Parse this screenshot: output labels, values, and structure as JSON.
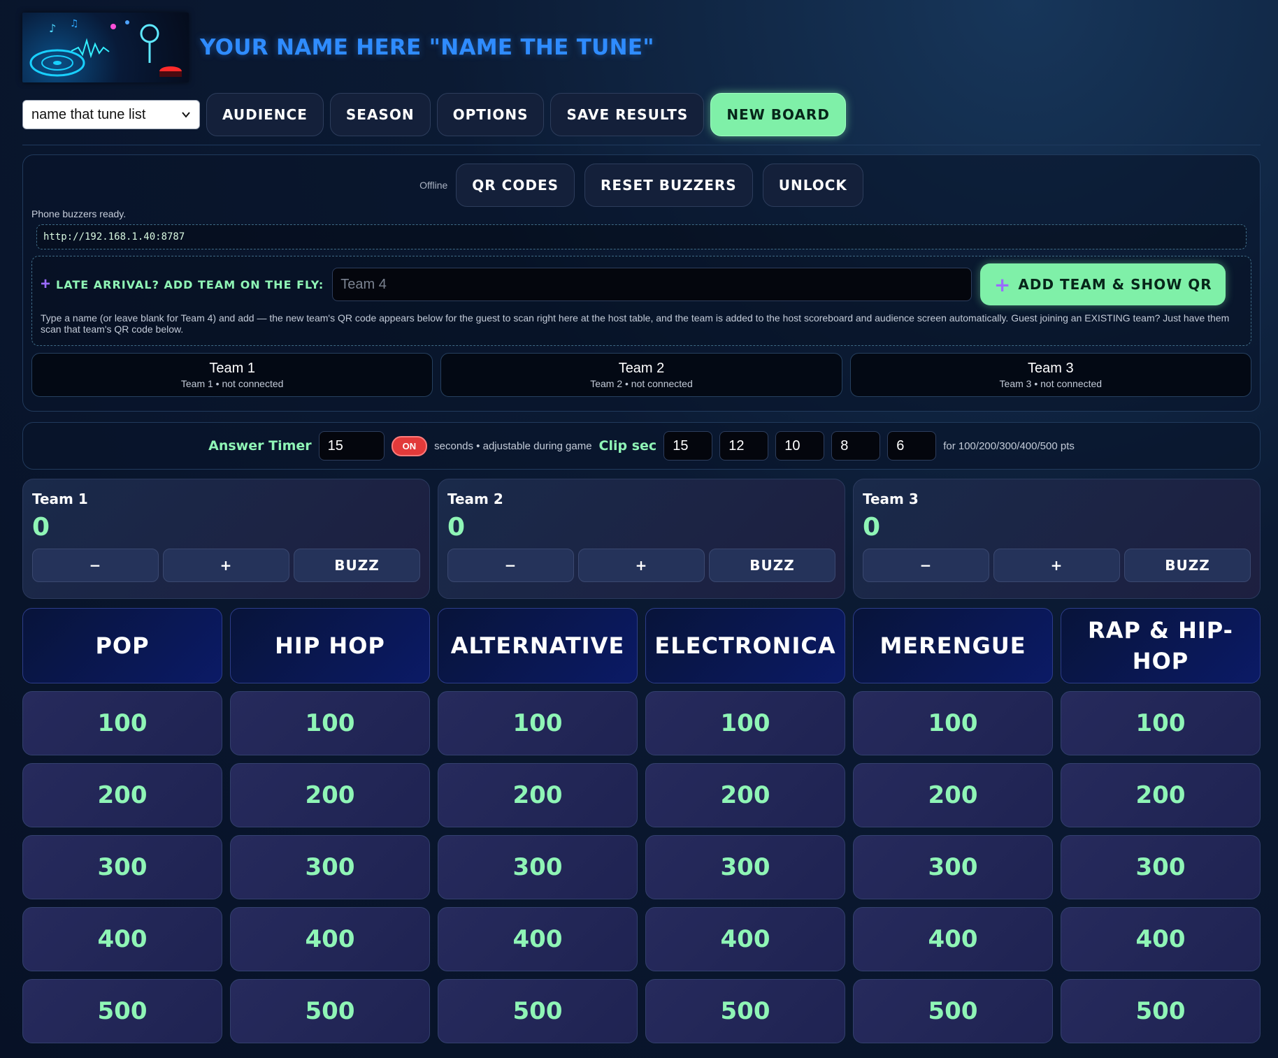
{
  "app": {
    "title": "YOUR NAME HERE \"NAME THE TUNE\""
  },
  "toolbar": {
    "list_select": "name that tune list",
    "buttons": [
      "AUDIENCE",
      "SEASON",
      "OPTIONS",
      "SAVE RESULTS",
      "NEW BOARD"
    ]
  },
  "buzzers": {
    "status": "Offline",
    "buttons": [
      "QR CODES",
      "RESET BUZZERS",
      "UNLOCK"
    ],
    "ready_text": "Phone buzzers ready.",
    "url": "http://192.168.1.40:8787",
    "late_label": "LATE ARRIVAL? ADD TEAM ON THE FLY:",
    "late_placeholder": "Team 4",
    "late_button": "ADD TEAM & SHOW QR",
    "late_note": "Type a name (or leave blank for Team 4) and add — the new team's QR code appears below for the guest to scan right here at the host table, and the team is added to the host scoreboard and audience screen automatically. Guest joining an EXISTING team? Just have them scan that team's QR code below.",
    "teams": [
      {
        "name": "Team 1",
        "status": "Team 1 • not connected"
      },
      {
        "name": "Team 2",
        "status": "Team 2 • not connected"
      },
      {
        "name": "Team 3",
        "status": "Team 3 • not connected"
      }
    ]
  },
  "timer": {
    "label": "Answer Timer",
    "seconds": "15",
    "toggle": "ON",
    "note": "seconds • adjustable during game",
    "clip_label": "Clip sec",
    "clips": [
      "15",
      "12",
      "10",
      "8",
      "6"
    ],
    "clip_note": "for 100/200/300/400/500 pts"
  },
  "scores": [
    {
      "name": "Team 1",
      "points": "0"
    },
    {
      "name": "Team 2",
      "points": "0"
    },
    {
      "name": "Team 3",
      "points": "0"
    }
  ],
  "score_buttons": {
    "minus": "−",
    "plus": "+",
    "buzz": "BUZZ"
  },
  "board": {
    "categories": [
      "POP",
      "HIP HOP",
      "ALTERNATIVE",
      "ELECTRONICA",
      "MERENGUE",
      "RAP & HIP-HOP"
    ],
    "values": [
      "100",
      "200",
      "300",
      "400",
      "500"
    ]
  },
  "colors": {
    "accent_green": "#7ff0a8",
    "title_blue": "#2f8cff",
    "toggle_red": "#e23a3a"
  }
}
